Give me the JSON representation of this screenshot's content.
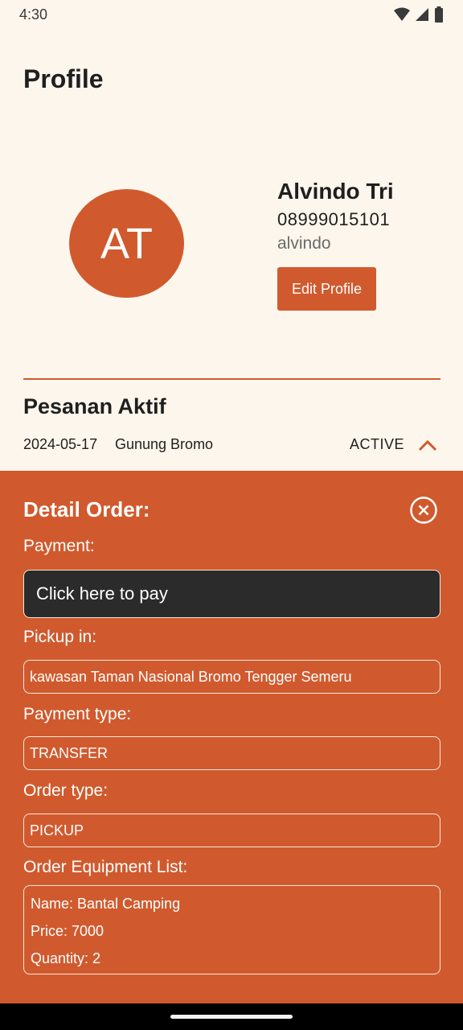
{
  "status_bar": {
    "time": "4:30",
    "icons": [
      "wifi-icon",
      "signal-icon",
      "battery-icon"
    ]
  },
  "page": {
    "title": "Profile"
  },
  "profile": {
    "initials": "AT",
    "name": "Alvindo Tri",
    "phone": "08999015101",
    "username": "alvindo",
    "edit_label": "Edit Profile"
  },
  "active_orders": {
    "title": "Pesanan Aktif",
    "order": {
      "date": "2024-05-17",
      "destination": "Gunung Bromo",
      "status": "ACTIVE"
    }
  },
  "detail": {
    "title": "Detail Order:",
    "payment_label": "Payment:",
    "pay_button": "Click here to pay",
    "pickup_label": "Pickup in:",
    "pickup_value": "kawasan Taman Nasional Bromo Tengger Semeru",
    "payment_type_label": "Payment type:",
    "payment_type_value": "TRANSFER",
    "order_type_label": "Order type:",
    "order_type_value": "PICKUP",
    "equipment_label": "Order Equipment List:",
    "equipment": {
      "name": "Name: Bantal Camping",
      "price": "Price: 7000",
      "quantity": "Quantity: 2"
    }
  },
  "colors": {
    "accent": "#d05a2e",
    "background": "#fdf6ec",
    "pay_button": "#2b2b2b"
  }
}
